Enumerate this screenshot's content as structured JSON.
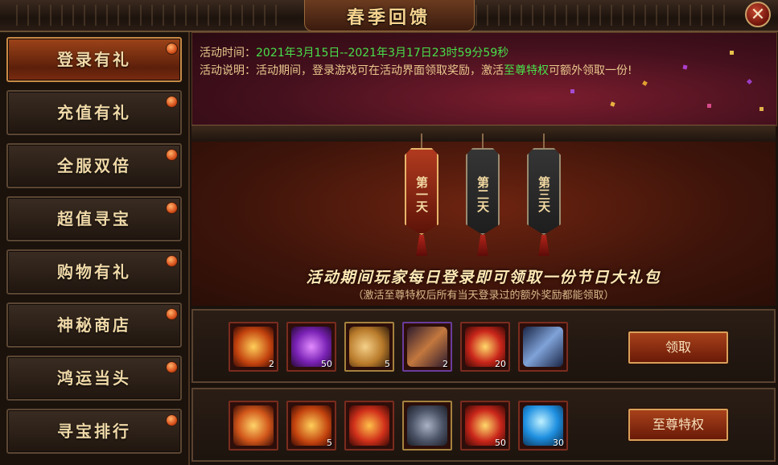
{
  "window": {
    "title": "春季回馈",
    "close_icon": "close-icon"
  },
  "sidebar": {
    "items": [
      {
        "label": "登录有礼",
        "active": true
      },
      {
        "label": "充值有礼"
      },
      {
        "label": "全服双倍"
      },
      {
        "label": "超值寻宝"
      },
      {
        "label": "购物有礼"
      },
      {
        "label": "神秘商店"
      },
      {
        "label": "鸿运当头"
      },
      {
        "label": "寻宝排行"
      }
    ]
  },
  "activity": {
    "time_label": "活动时间：",
    "time_value": "2021年3月15日--2021年3月17日23时59分59秒",
    "desc_label": "活动说明：",
    "desc_text_1": "活动期间，登录游戏可在活动界面领取奖励，激活",
    "desc_highlight": "至尊特权",
    "desc_text_2": "可额外领取一份!"
  },
  "days": [
    {
      "label": "第一天",
      "active": true
    },
    {
      "label": "第二天"
    },
    {
      "label": "第三天"
    }
  ],
  "headline": "活动期间玩家每日登录即可领取一份节日大礼包",
  "subline": "（激活至尊特权后所有当天登录过的额外奖励都能领取）",
  "reward_rows": [
    {
      "button": "领取",
      "items": [
        {
          "icon": "golden-key-icon",
          "count": "2",
          "border": "red"
        },
        {
          "icon": "purple-orb-icon",
          "count": "50",
          "border": "red"
        },
        {
          "icon": "horn-icon",
          "count": "5",
          "border": "gold"
        },
        {
          "icon": "scroll-icon",
          "count": "2",
          "border": "purple"
        },
        {
          "icon": "medal-icon",
          "count": "20",
          "border": "red"
        },
        {
          "icon": "map-scroll-icon",
          "count": "",
          "border": "red"
        }
      ]
    },
    {
      "button": "至尊特权",
      "items": [
        {
          "icon": "treasure-chest-icon",
          "count": "",
          "border": "red"
        },
        {
          "icon": "golden-key-icon",
          "count": "5",
          "border": "red"
        },
        {
          "icon": "firecracker-icon",
          "count": "",
          "border": "red"
        },
        {
          "icon": "iron-chest-icon",
          "count": "",
          "border": "gold"
        },
        {
          "icon": "medal-icon",
          "count": "50",
          "border": "red"
        },
        {
          "icon": "blue-gem-icon",
          "count": "30",
          "border": "red"
        }
      ]
    }
  ]
}
